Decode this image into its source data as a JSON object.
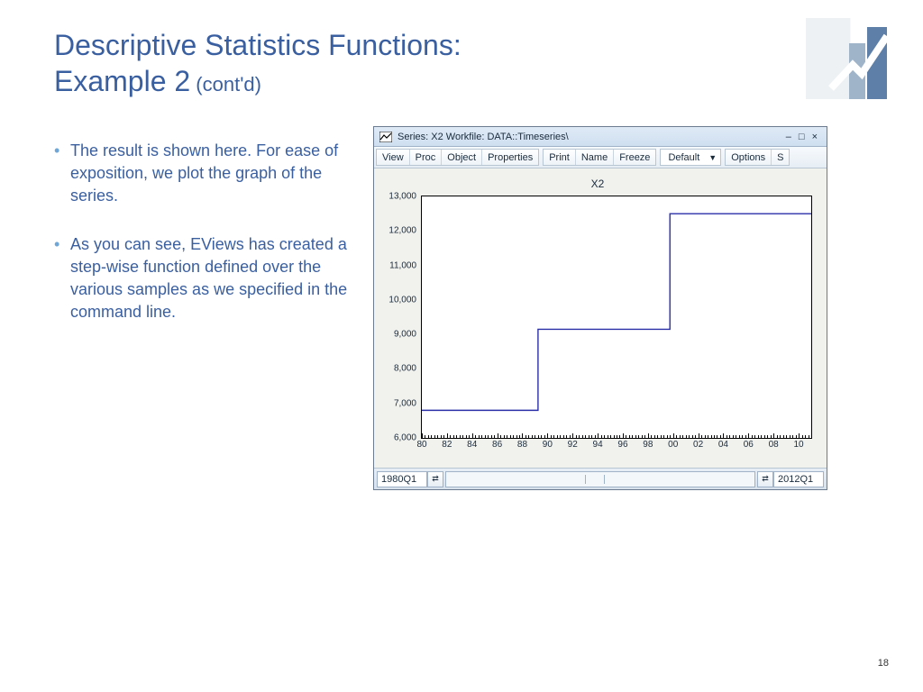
{
  "slide": {
    "title_line1": "Descriptive Statistics Functions:",
    "title_line2": "Example 2",
    "title_contd": " (cont'd)",
    "page_number": "18"
  },
  "bullets": [
    "The result is shown here. For ease of exposition, we plot the graph of the series.",
    "As you can see, EViews has created a step-wise function defined over the various samples as we specified in the command line."
  ],
  "window": {
    "title": "Series: X2   Workfile: DATA::Timeseries\\",
    "toolbar": {
      "group1": [
        "View",
        "Proc",
        "Object",
        "Properties"
      ],
      "group2": [
        "Print",
        "Name",
        "Freeze"
      ],
      "select": "Default",
      "group3": [
        "Options",
        "S"
      ]
    },
    "range": {
      "start": "1980Q1",
      "end": "2012Q1"
    }
  },
  "chart_data": {
    "type": "line",
    "title": "X2",
    "xlabel": "",
    "ylabel": "",
    "x_ticks": [
      "80",
      "82",
      "84",
      "86",
      "88",
      "90",
      "92",
      "94",
      "96",
      "98",
      "00",
      "02",
      "04",
      "06",
      "08",
      "10"
    ],
    "ylim": [
      6000,
      13000
    ],
    "y_ticks": [
      6000,
      7000,
      8000,
      9000,
      10000,
      11000,
      12000,
      13000
    ],
    "y_tick_labels": [
      "6,000",
      "7,000",
      "8,000",
      "9,000",
      "10,000",
      "11,000",
      "12,000",
      "13,000"
    ],
    "series": [
      {
        "name": "X2",
        "color": "#2a2fa8",
        "segments": [
          {
            "x_start": 80.0,
            "x_end": 89.25,
            "value": 6800
          },
          {
            "x_start": 89.25,
            "x_end": 99.75,
            "value": 9150
          },
          {
            "x_start": 99.75,
            "x_end": 111.0,
            "value": 12500
          }
        ]
      }
    ]
  }
}
